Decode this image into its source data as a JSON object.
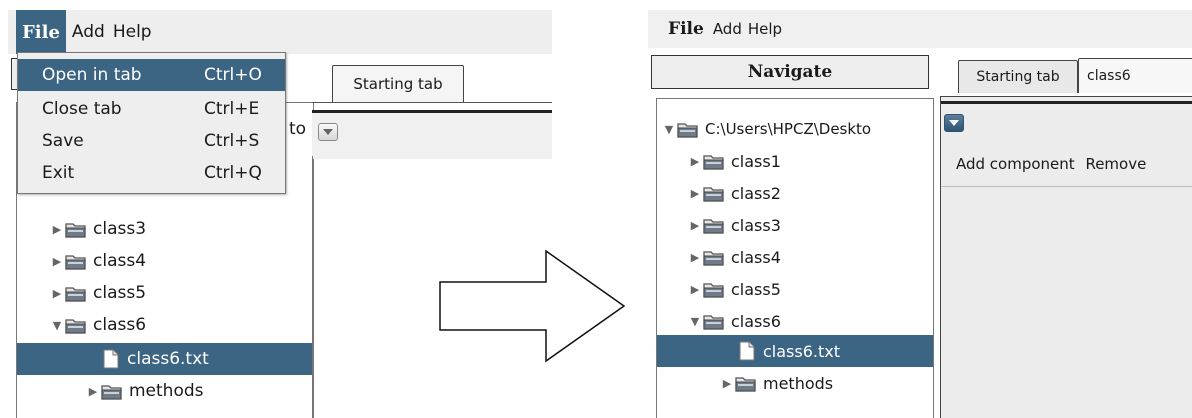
{
  "left": {
    "menu": {
      "file": "File",
      "add": "Add",
      "help": "Help"
    },
    "file_menu": [
      {
        "label": "Open in tab",
        "accel": "Ctrl+O"
      },
      {
        "label": "Close tab",
        "accel": "Ctrl+E"
      },
      {
        "label": "Save",
        "accel": "Ctrl+S"
      },
      {
        "label": "Exit",
        "accel": "Ctrl+Q"
      }
    ],
    "clipped_path_fragment": "to",
    "tab": "Starting tab",
    "tree": [
      {
        "label": "class3"
      },
      {
        "label": "class4"
      },
      {
        "label": "class5"
      },
      {
        "label": "class6"
      },
      {
        "label": "class6.txt"
      },
      {
        "label": "methods"
      }
    ]
  },
  "right": {
    "menu": {
      "file": "File",
      "add": "Add",
      "help": "Help"
    },
    "navigate": "Navigate",
    "tabs": [
      {
        "label": "Starting tab"
      },
      {
        "label": "class6"
      }
    ],
    "toolbar": {
      "add": "Add component",
      "remove": "Remove"
    },
    "tree": [
      {
        "label": "C:\\Users\\HPCZ\\Deskto"
      },
      {
        "label": "class1"
      },
      {
        "label": "class2"
      },
      {
        "label": "class3"
      },
      {
        "label": "class4"
      },
      {
        "label": "class5"
      },
      {
        "label": "class6"
      },
      {
        "label": "class6.txt"
      },
      {
        "label": "methods"
      }
    ]
  },
  "colors": {
    "selection": "#3c6584",
    "menubar": "#eeeeee"
  }
}
